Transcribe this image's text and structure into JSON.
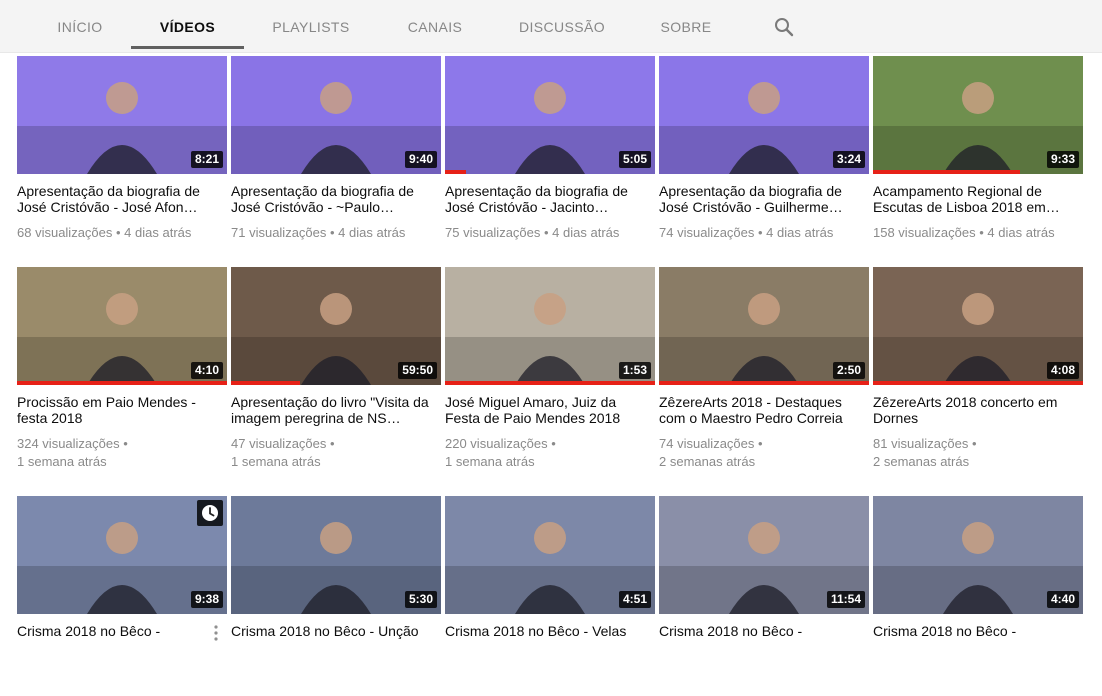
{
  "tabs": [
    {
      "label": "INÍCIO"
    },
    {
      "label": "VÍDEOS"
    },
    {
      "label": "PLAYLISTS"
    },
    {
      "label": "CANAIS"
    },
    {
      "label": "DISCUSSÃO"
    },
    {
      "label": "SOBRE"
    }
  ],
  "colors": {
    "accent": "#e62117",
    "tab_active": "#0d0d0d",
    "tab_inactive": "#878787",
    "meta_text": "#8a8a8a"
  },
  "icons": {
    "search": "search-icon",
    "watch_later": "clock-icon",
    "menu": "more-vert-icon"
  },
  "videos": [
    {
      "duration": "8:21",
      "title": "Apresentação da biografia de José Cristóvão - José Afon…",
      "views": "68 visualizações",
      "age": "4 dias atrás",
      "thumb_color": "#8f7ae8",
      "progress_fraction": 0
    },
    {
      "duration": "9:40",
      "title": "Apresentação da biografia de José Cristóvão - ~Paulo…",
      "views": "71 visualizações",
      "age": "4 dias atrás",
      "thumb_color": "#8a74e6",
      "progress_fraction": 0
    },
    {
      "duration": "5:05",
      "title": "Apresentação da biografia de José Cristóvão - Jacinto…",
      "views": "75 visualizações",
      "age": "4 dias atrás",
      "thumb_color": "#8d78ea",
      "progress_fraction": 0.1
    },
    {
      "duration": "3:24",
      "title": "Apresentação da biografia de José Cristóvão - Guilherme…",
      "views": "74 visualizações",
      "age": "4 dias atrás",
      "thumb_color": "#8b76e8",
      "progress_fraction": 0
    },
    {
      "duration": "9:33",
      "title": "Acampamento Regional de Escutas de Lisboa 2018 em…",
      "views": "158 visualizações",
      "age": "4 dias atrás",
      "thumb_color": "#6f8f4e",
      "progress_fraction": 0.7
    },
    {
      "duration": "4:10",
      "title": "Procissão em Paio Mendes - festa 2018",
      "views": "324 visualizações",
      "age": "1 semana atrás",
      "thumb_color": "#9a8b6a",
      "progress_fraction": 1
    },
    {
      "duration": "59:50",
      "title": "Apresentação do livro \"Visita da imagem peregrina de NS…",
      "views": "47 visualizações",
      "age": "1 semana atrás",
      "thumb_color": "#6e5a4a",
      "progress_fraction": 0.33
    },
    {
      "duration": "1:53",
      "title": "José Miguel Amaro, Juiz da Festa de Paio Mendes 2018",
      "views": "220 visualizações",
      "age": "1 semana atrás",
      "thumb_color": "#b8b0a2",
      "progress_fraction": 1
    },
    {
      "duration": "2:50",
      "title": "ZêzereArts 2018 - Destaques com o Maestro Pedro Correia",
      "views": "74 visualizações",
      "age": "2 semanas atrás",
      "thumb_color": "#8a7c66",
      "progress_fraction": 1
    },
    {
      "duration": "4:08",
      "title": "ZêzereArts 2018 concerto em Dornes",
      "views": "81 visualizações",
      "age": "2 semanas atrás",
      "thumb_color": "#7a6454",
      "progress_fraction": 1
    },
    {
      "duration": "9:38",
      "title": "Crisma 2018 no Bêco -",
      "views": "",
      "age": "",
      "thumb_color": "#7c89ad",
      "progress_fraction": 0
    },
    {
      "duration": "5:30",
      "title": "Crisma 2018 no Bêco - Unção",
      "views": "",
      "age": "",
      "thumb_color": "#6d7a9a",
      "progress_fraction": 0
    },
    {
      "duration": "4:51",
      "title": "Crisma 2018 no Bêco - Velas",
      "views": "",
      "age": "",
      "thumb_color": "#7d88a8",
      "progress_fraction": 0
    },
    {
      "duration": "11:54",
      "title": "Crisma 2018 no Bêco -",
      "views": "",
      "age": "",
      "thumb_color": "#8a8fa8",
      "progress_fraction": 0
    },
    {
      "duration": "4:40",
      "title": "Crisma 2018 no Bêco -",
      "views": "",
      "age": "",
      "thumb_color": "#7e86a2",
      "progress_fraction": 0
    }
  ]
}
